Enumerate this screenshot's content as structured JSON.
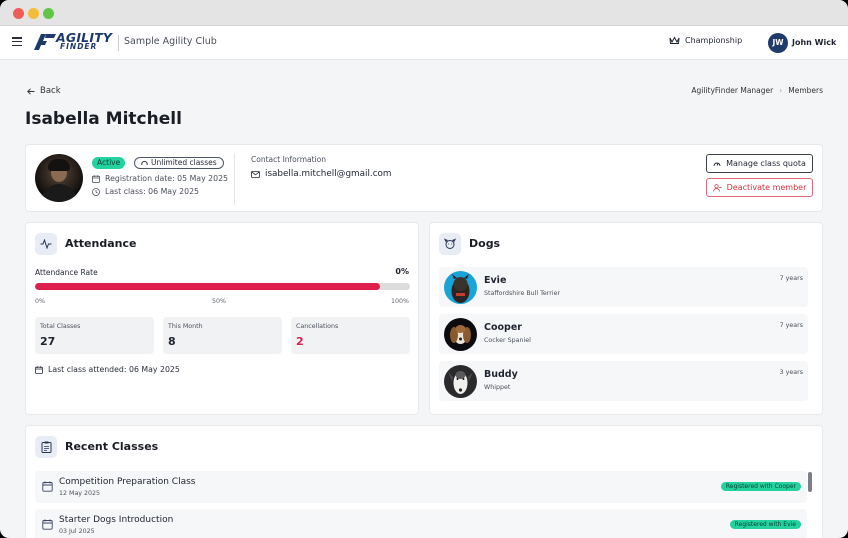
{
  "app": {
    "logo_line1": "AGILITY",
    "logo_line2": "FINDER",
    "club_name": "Sample Agility Club",
    "championship_label": "Championship",
    "user_initials": "JW",
    "user_name": "John Wick"
  },
  "nav": {
    "back_label": "Back",
    "breadcrumb": [
      "AgilityFinder Manager",
      "Members"
    ]
  },
  "member": {
    "name": "Isabella Mitchell",
    "status": "Active",
    "plan": "Unlimited classes",
    "registration": "Registration date: 05 May 2025",
    "last_class": "Last class: 06 May 2025",
    "contact_label": "Contact Information",
    "email": "isabella.mitchell@gmail.com",
    "manage_quota_label": "Manage class quota",
    "deactivate_label": "Deactivate member"
  },
  "attendance": {
    "title": "Attendance",
    "rate_label": "Attendance Rate",
    "rate_value": "0%",
    "bar_fill_fraction": 0.92,
    "scale": [
      "0%",
      "50%",
      "100%"
    ],
    "stats": [
      {
        "label": "Total Classes",
        "value": "27"
      },
      {
        "label": "This Month",
        "value": "8"
      },
      {
        "label": "Cancellations",
        "value": "2"
      }
    ],
    "last_attended": "Last class attended: 06 May 2025"
  },
  "dogs": {
    "title": "Dogs",
    "items": [
      {
        "name": "Evie",
        "breed": "Staffordshire Bull Terrier",
        "age": "7 years"
      },
      {
        "name": "Cooper",
        "breed": "Cocker Spaniel",
        "age": "7 years"
      },
      {
        "name": "Buddy",
        "breed": "Whippet",
        "age": "3 years"
      }
    ]
  },
  "recent_classes": {
    "title": "Recent Classes",
    "items": [
      {
        "name": "Competition Preparation Class",
        "date": "12 May 2025",
        "badge": "Registered with Cooper"
      },
      {
        "name": "Starter Dogs Introduction",
        "date": "03 Jul 2025",
        "badge": "Registered with Evie"
      }
    ]
  },
  "colors": {
    "accent_green": "#22d3a0",
    "danger_red": "#dc1f4d",
    "brand_navy": "#1e3a6d"
  }
}
